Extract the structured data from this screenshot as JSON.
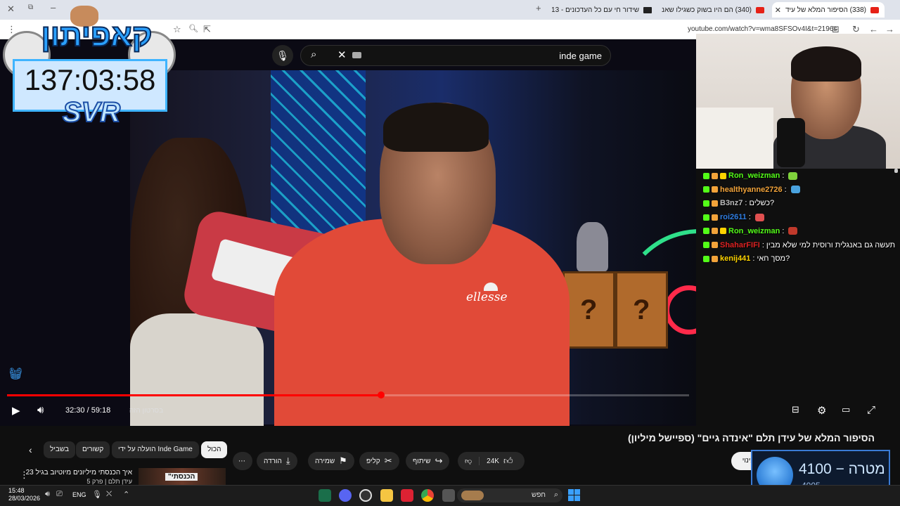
{
  "browser": {
    "tabs": [
      {
        "title": "(338) הסיפור המלא של עיד",
        "active": true
      },
      {
        "title": "(340) הם היו בשוק כשגילו שאנ",
        "active": false
      },
      {
        "title": "שידור חי עם כל העדכונים - 13+",
        "active": false
      }
    ],
    "new_tab": "+",
    "close_window": "✕",
    "url": "youtube.com/watch?v=wma8SFSOv4I&t=2196s"
  },
  "overlay": {
    "channel_logo": "קאפיתון",
    "timer": "137:03:58",
    "badge_text": "SVR"
  },
  "youtube": {
    "search_value": "inde game",
    "player": {
      "time": "32:30 / 59:18",
      "chapter": "בסרטון הזה",
      "progress": 0.548
    },
    "video_title": "הסיפור המלא של עידן תלם \"אינדה גיים\" (ספיישל מיליון)",
    "chips": [
      "הכול",
      "הועלה על ידי Inde Game",
      "קשורים",
      "בשביל"
    ],
    "actions": {
      "like_count": "24K",
      "share": "שיתוף",
      "clip": "קליפ",
      "save": "שמירה",
      "download": "הורדה"
    },
    "subscribe_partial": "מינוי",
    "recommended": {
      "title": "איך הכנסתי מיליונים מיוטיוב בגיל 23",
      "subtitle": "עידן תלם | פרק 5",
      "thumb_text": "\"הכנסתי"
    },
    "shirt_brand": "ellesse"
  },
  "chat": [
    {
      "user": "Ron_weizman",
      "user_color": "#53fc18",
      "msg": "",
      "badges": [
        "k",
        "s",
        "c"
      ],
      "emote": "#7fd23c"
    },
    {
      "user": "healthyanne2726",
      "user_color": "#f2a33a",
      "msg": "",
      "badges": [
        "k",
        "s"
      ],
      "emote": "#4aa3df"
    },
    {
      "user": "B3nz7",
      "user_color": "#bbbbbb",
      "msg": "כשלים?",
      "badges": [
        "k",
        "s"
      ]
    },
    {
      "user": "roi2611",
      "user_color": "#2f7de1",
      "msg": "",
      "badges": [
        "k",
        "s"
      ],
      "emote": "#e05050"
    },
    {
      "user": "Ron_weizman",
      "user_color": "#53fc18",
      "msg": "",
      "badges": [
        "k",
        "s",
        "c"
      ],
      "emote": "#c0392b"
    },
    {
      "user": "ShaharFIFI",
      "user_color": "#d22",
      "msg": "תעשה גם באנגלית ורוסית למי שלא מבין",
      "badges": [
        "k",
        "s"
      ]
    },
    {
      "user": "kenij441",
      "user_color": "#ffd400",
      "msg": "מסך חאי?",
      "badges": [
        "k",
        "s"
      ]
    }
  ],
  "goal": {
    "label": "מטרה",
    "current": "4100",
    "target": "4005"
  },
  "taskbar": {
    "time": "15:48",
    "date": "28/03/2026",
    "language": "ENG",
    "search_label": "חפש"
  },
  "colors": {
    "youtube_red": "#ff0000",
    "kick_green": "#53fc18",
    "timer_border": "#3fb4ff"
  }
}
